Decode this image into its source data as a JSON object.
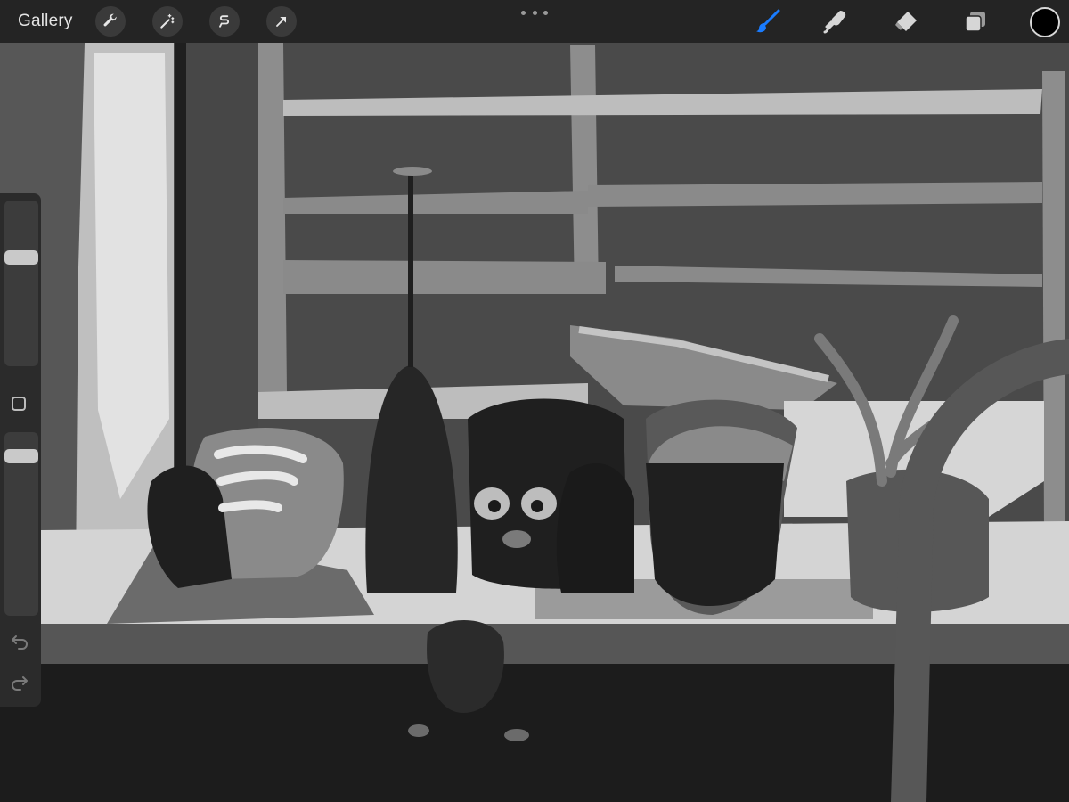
{
  "app": {
    "gallery_label": "Gallery"
  },
  "toolbar": {
    "left_tools": [
      {
        "name": "actions-wrench-icon"
      },
      {
        "name": "adjustments-wand-icon"
      },
      {
        "name": "selection-s-icon"
      },
      {
        "name": "transform-arrow-icon"
      }
    ],
    "right_tools": [
      {
        "name": "brush-icon",
        "active": true
      },
      {
        "name": "smudge-icon",
        "active": false
      },
      {
        "name": "eraser-icon",
        "active": false
      },
      {
        "name": "layers-icon",
        "active": false
      }
    ],
    "active_color": "#000000",
    "accent": "#1a7cff"
  },
  "sidebar": {
    "brush_size_level": 0.67,
    "opacity_level": 0.9
  }
}
